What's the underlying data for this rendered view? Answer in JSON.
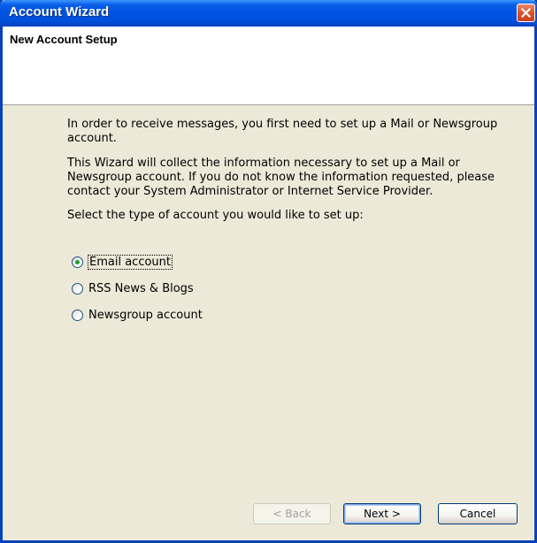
{
  "window": {
    "title": "Account Wizard"
  },
  "header": {
    "title": "New Account Setup"
  },
  "body": {
    "intro": "In order to receive messages, you first need to set up a Mail or Newsgroup account.",
    "info": "This Wizard will collect the information necessary to set up a Mail or Newsgroup account. If you do not know the information requested, please contact your System Administrator or Internet Service Provider.",
    "prompt": "Select the type of account you would like to set up:"
  },
  "account_types": {
    "selected": "Email account",
    "options": [
      {
        "label": "Email account",
        "checked": true
      },
      {
        "label": "RSS News & Blogs",
        "checked": false
      },
      {
        "label": "Newsgroup account",
        "checked": false
      }
    ]
  },
  "buttons": {
    "back": "< Back",
    "next": "Next >",
    "cancel": "Cancel"
  },
  "colors": {
    "titlebar": "#0054e3",
    "dialog_face": "#ece9d8",
    "close_button": "#d9532b",
    "radio_dot": "#21a121"
  },
  "icons": {
    "close": "close-icon"
  }
}
